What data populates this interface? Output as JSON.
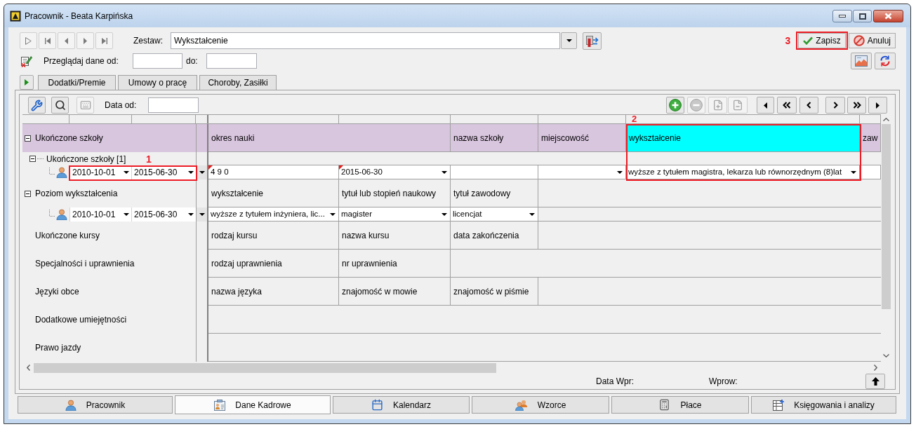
{
  "window": {
    "title": "Pracownik - Beata Karpińska"
  },
  "header": {
    "set_label": "Zestaw:",
    "set_value": "Wykształcenie",
    "annotation": "3",
    "actions": [
      {
        "kind": "save",
        "label": "Zapisz"
      },
      {
        "kind": "cancel",
        "label": "Anuluj"
      }
    ],
    "browse_label": "Przeglądaj dane od:",
    "to_label": "do:"
  },
  "tabs": [
    {
      "label": "Dodatki/Premie",
      "selected": false
    },
    {
      "label": "Umowy o pracę",
      "selected": false
    },
    {
      "label": "Choroby, Zasiłki",
      "selected": false
    }
  ],
  "panel_toolbar": {
    "date_label": "Data od:"
  },
  "grid": {
    "column_annotation": "2",
    "sections": [
      {
        "label": "Ukończone szkoły",
        "expanded": true,
        "selected": true,
        "columns": [
          {
            "label": "okres nauki",
            "kind": "wide",
            "selected": false
          },
          {
            "label": "nazwa szkoły",
            "kind": "normal",
            "selected": false
          },
          {
            "label": "miejscowość",
            "kind": "normal",
            "selected": false
          },
          {
            "label": "wykształcenie",
            "kind": "normal",
            "selected": true
          },
          {
            "label": "zaw",
            "kind": "normal",
            "selected": false
          }
        ],
        "children": [
          {
            "label": "Ukończone szkoły [1]",
            "expanded": true,
            "annotation": "1",
            "records": [
              {
                "date_from": "2010-10-01",
                "date_to": "2015-06-30",
                "cells": [
                  {
                    "kind": "text",
                    "value": "4 9 0",
                    "flagged": true
                  },
                  {
                    "kind": "dropdown",
                    "value": "2015-06-30",
                    "flagged": true
                  },
                  {
                    "kind": "text",
                    "flagged": false
                  },
                  {
                    "kind": "dropdown",
                    "flagged": false
                  },
                  {
                    "kind": "dropdown",
                    "value": "wyższe z tytułem magistra, lekarza lub równorzędnym (8)lat",
                    "flagged": false
                  },
                  {
                    "kind": "text",
                    "flagged": false
                  }
                ]
              }
            ]
          }
        ]
      },
      {
        "label": "Poziom wykształcenia",
        "expanded": true,
        "selected": false,
        "columns": [
          {
            "label": "wykształcenie",
            "selected": false
          },
          {
            "label": "tytuł lub stopień naukowy",
            "selected": false
          },
          {
            "label": "tytuł zawodowy",
            "selected": false
          }
        ],
        "records": [
          {
            "date_from": "2010-10-01",
            "date_to": "2015-06-30",
            "cells": [
              {
                "kind": "dropdown",
                "value": "wyższe z tytułem inżyniera, lic...",
                "flagged": false
              },
              {
                "kind": "dropdown",
                "value": "magister",
                "flagged": false
              },
              {
                "kind": "dropdown",
                "value": "licencjat",
                "flagged": false
              }
            ]
          }
        ]
      },
      {
        "label": "Ukończone kursy",
        "selected": false,
        "columns": [
          {
            "label": "rodzaj kursu",
            "selected": false
          },
          {
            "label": "nazwa kursu",
            "selected": false
          },
          {
            "label": "data zakończenia",
            "selected": false
          }
        ]
      },
      {
        "label": "Specjalności i uprawnienia",
        "selected": false,
        "columns": [
          {
            "label": "rodzaj uprawnienia",
            "selected": false
          },
          {
            "label": "nr uprawnienia",
            "selected": false
          }
        ]
      },
      {
        "label": "Języki obce",
        "selected": false,
        "columns": [
          {
            "label": "nazwa języka",
            "selected": false
          },
          {
            "label": "znajomość w mowie",
            "selected": false
          },
          {
            "label": "znajomość w piśmie",
            "selected": false
          }
        ]
      },
      {
        "label": "Dodatkowe umiejętności",
        "selected": false
      },
      {
        "label": "Prawo jazdy",
        "selected": false
      }
    ]
  },
  "footer": {
    "entry_date_label": "Data Wpr:",
    "entered_by_label": "Wprow:"
  },
  "bottom_tabs": [
    {
      "label": "Pracownik",
      "selected": false
    },
    {
      "label": "Dane Kadrowe",
      "selected": true
    },
    {
      "label": "Kalendarz",
      "selected": false
    },
    {
      "label": "Wzorce",
      "selected": false
    },
    {
      "label": "Płace",
      "selected": false
    },
    {
      "label": "Księgowania i analizy",
      "selected": false
    }
  ]
}
